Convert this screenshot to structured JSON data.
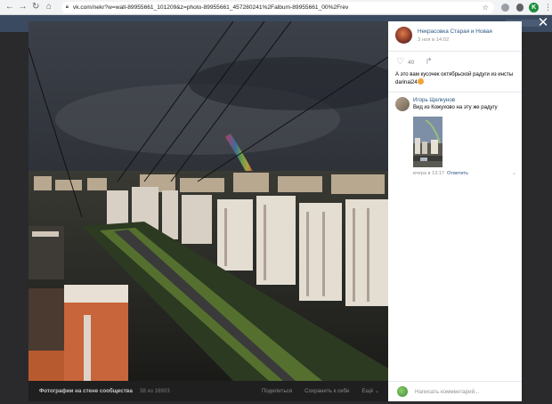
{
  "browser": {
    "url": "vk.com/nekr?w=wall-89955661_101209&z=photo-89955661_457280241%2Falbum-89955661_00%2Frev",
    "profile_initial": "K"
  },
  "viewer": {
    "close_glyph": "✕"
  },
  "post": {
    "group_name": "Некрасовка Старая и Новая",
    "date": "3 ноя в 14:02",
    "likes": "40",
    "text": "А это вам кусочек октябрьской радуги из инсты darinai24"
  },
  "comment": {
    "author": "Игорь Щелкунов",
    "text": "Вид из Кожухово на эту же радугу",
    "time": "вчера в 13:17",
    "reply_label": "Ответить"
  },
  "composer": {
    "placeholder": "Написать комментарий..."
  },
  "photo_footer": {
    "album_title": "Фотографии на стене сообщества",
    "counter": "38 из 16903",
    "share": "Поделиться",
    "save": "Сохранить к себе",
    "more": "Ещё ⌄"
  },
  "icons": {
    "back": "back-arrow-icon",
    "forward": "forward-arrow-icon",
    "reload": "reload-icon",
    "home": "home-icon",
    "lock": "lock-icon",
    "star": "star-icon",
    "heart": "heart-icon",
    "share": "share-arrow-icon",
    "close": "close-icon"
  },
  "colors": {
    "link": "#2a5885",
    "meta": "#939393",
    "overlay": "#2a2a2c"
  }
}
